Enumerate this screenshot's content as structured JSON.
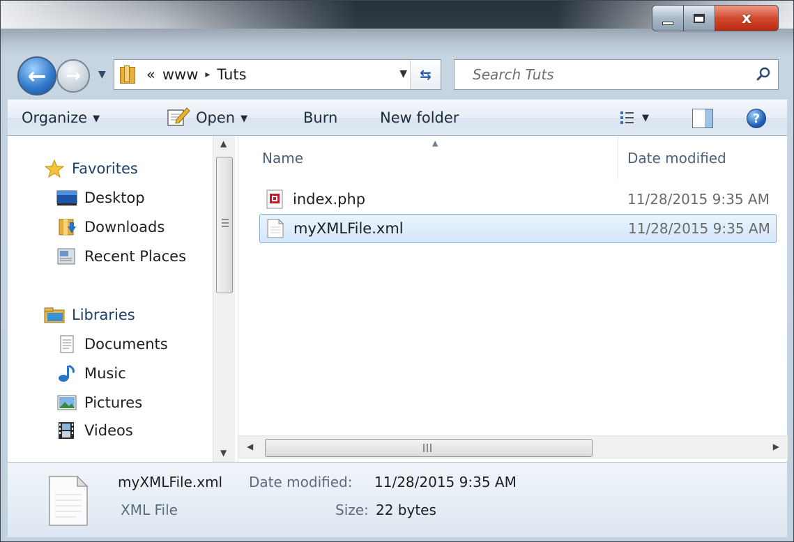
{
  "window": {
    "close_glyph": "x"
  },
  "address": {
    "overflow": "«",
    "crumbs": [
      "www",
      "Tuts"
    ],
    "separator": "▸"
  },
  "search": {
    "placeholder": "Search Tuts"
  },
  "toolbar": {
    "organize": "Organize",
    "open": "Open",
    "burn": "Burn",
    "new_folder": "New folder",
    "dropdown_glyph": "▼"
  },
  "nav": {
    "favorites": {
      "label": "Favorites",
      "items": [
        "Desktop",
        "Downloads",
        "Recent Places"
      ]
    },
    "libraries": {
      "label": "Libraries",
      "items": [
        "Documents",
        "Music",
        "Pictures",
        "Videos"
      ]
    }
  },
  "filelist": {
    "columns": {
      "name": "Name",
      "date": "Date modified"
    },
    "files": [
      {
        "name": "index.php",
        "date": "11/28/2015 9:35 AM",
        "icon": "php-file-icon",
        "selected": false
      },
      {
        "name": "myXMLFile.xml",
        "date": "11/28/2015 9:35 AM",
        "icon": "xml-file-icon",
        "selected": true
      }
    ]
  },
  "details": {
    "filename": "myXMLFile.xml",
    "date_label": "Date modified:",
    "date_value": "11/28/2015 9:35 AM",
    "type": "XML File",
    "size_label": "Size:",
    "size_value": "22 bytes"
  },
  "colors": {
    "accent": "#2e76c8",
    "selection": "#d4e7fb",
    "close_button": "#d24a2d"
  }
}
